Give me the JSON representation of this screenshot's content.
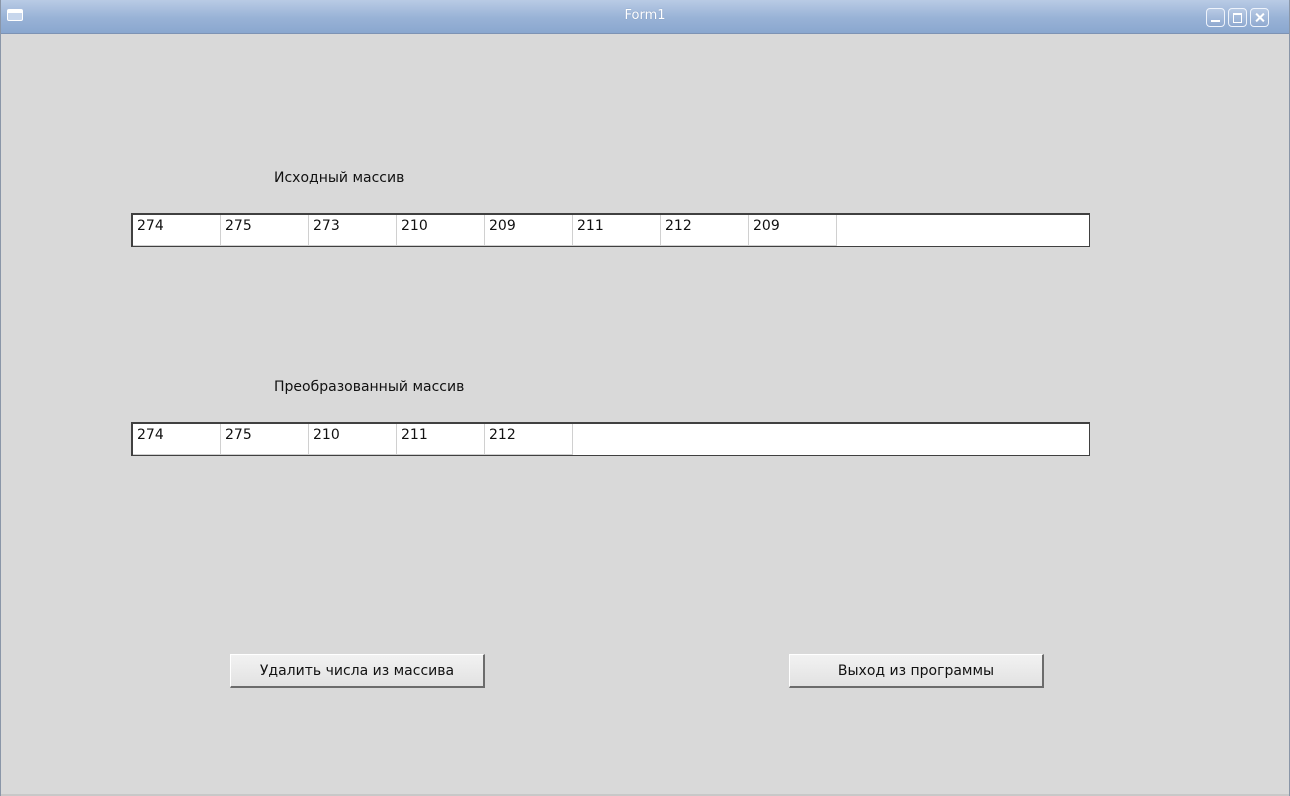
{
  "window": {
    "title": "Form1",
    "controls": [
      "minimize-icon",
      "maximize-icon",
      "close-icon"
    ]
  },
  "source_array": {
    "label": "Исходный массив",
    "values": [
      "274",
      "275",
      "273",
      "210",
      "209",
      "211",
      "212",
      "209"
    ]
  },
  "result_array": {
    "label": "Преобразованный массив",
    "values": [
      "274",
      "275",
      "210",
      "211",
      "212"
    ]
  },
  "buttons": {
    "delete_label": "Удалить числа из массива",
    "exit_label": "Выход из программы"
  }
}
